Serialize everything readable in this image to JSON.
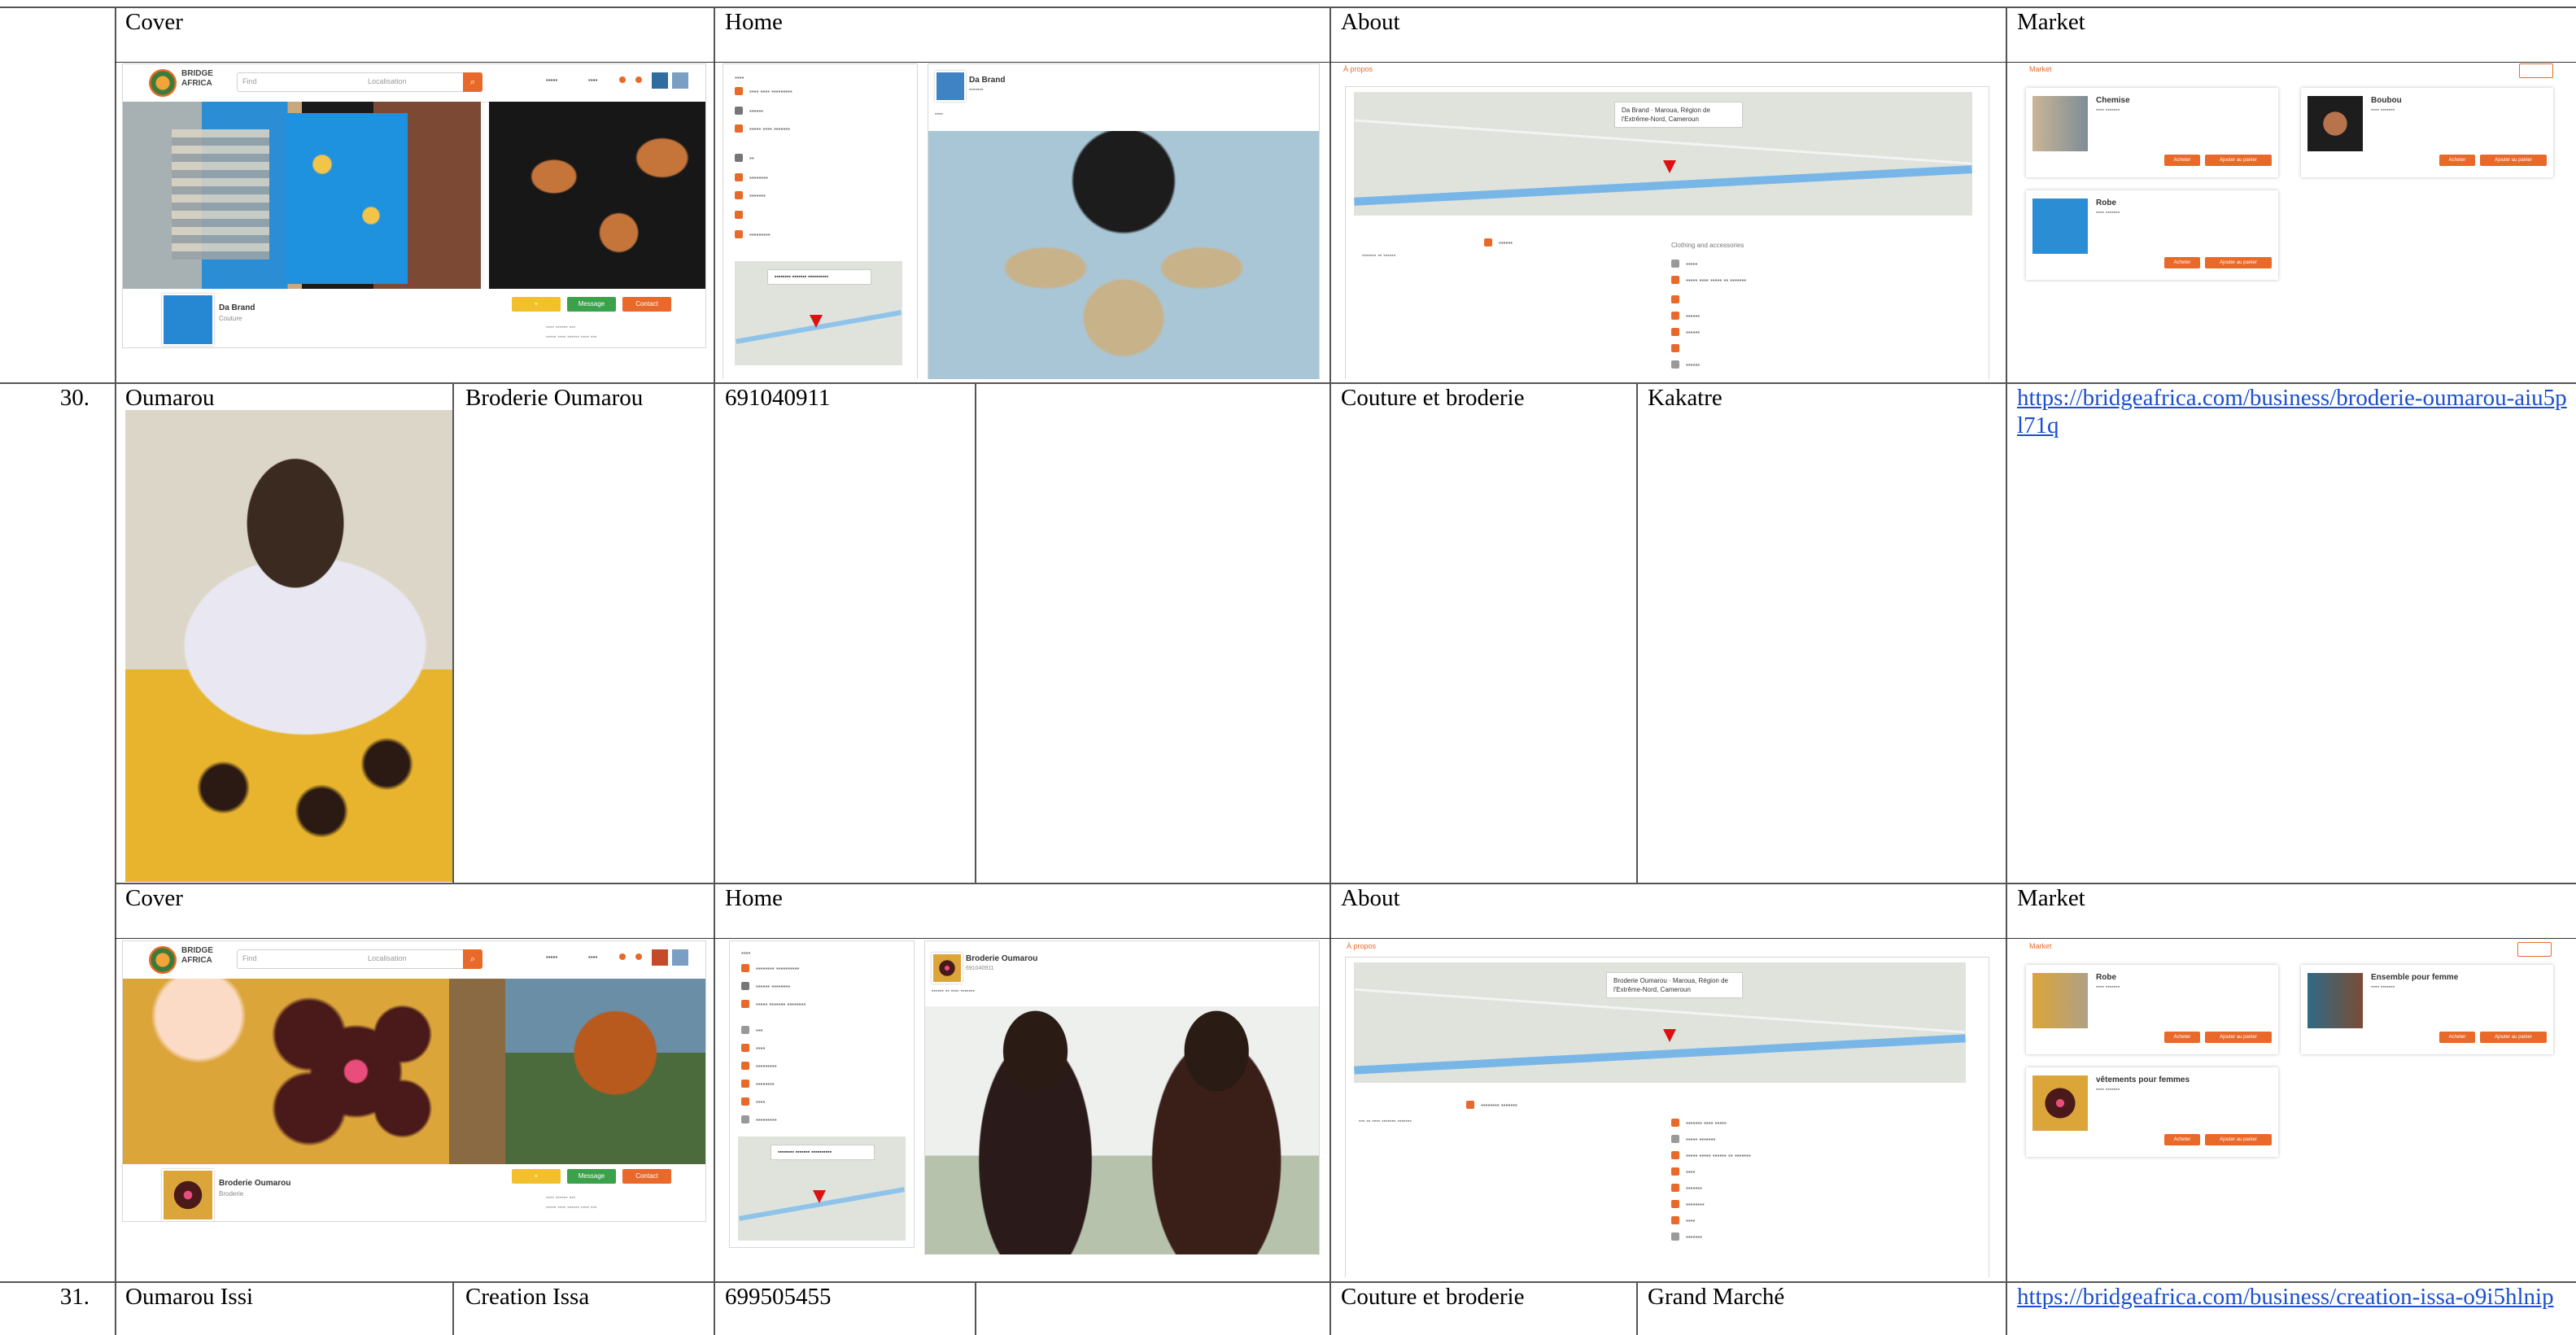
{
  "headers_top": {
    "cover": "Cover",
    "home": "Home",
    "about": "About",
    "market": "Market"
  },
  "row30": {
    "number": "30.",
    "owner": "Oumarou",
    "business": "Broderie Oumarou",
    "phone": "691040911",
    "category": "Couture et broderie",
    "location": "Kakatre",
    "url": "https://bridgeafrica.com/business/broderie-oumarou-aiu5pl71q"
  },
  "headers_mid": {
    "cover": "Cover",
    "home": "Home",
    "about": "About",
    "market": "Market"
  },
  "row31": {
    "number": "31.",
    "owner": "Oumarou Issi",
    "business": "Creation Issa",
    "phone": "699505455",
    "category": "Couture et broderie",
    "location": "Grand Marché",
    "url": "https://bridgeafrica.com/business/creation-issa-o9i5hlnip"
  },
  "shots": {
    "logo_text": "BRIDGE AFRICA",
    "search_what": "Find",
    "search_where": "Localisation",
    "top_profile_name": "Da Brand",
    "top_profile_sub": "Couture",
    "mid_profile_name": "Broderie Oumarou",
    "mid_profile_sub": "Broderie",
    "btn_message": "Message",
    "btn_contact": "Contact",
    "top_home_post_name": "Da Brand",
    "mid_home_post_name": "Broderie Oumarou",
    "mid_home_post_phone": "691040911",
    "map_callout_top": "Da Brand · Maroua, Région de l'Extrême-Nord, Cameroun",
    "map_callout_mid": "Broderie Oumarou · Maroua, Région de l'Extrême-Nord, Cameroun",
    "about_label": "À propos",
    "about_cat": "Clothing and accessories",
    "market_label": "Market",
    "top_market_items": [
      "Chemise",
      "Boubou",
      "Robe"
    ],
    "mid_market_items": [
      "Robe",
      "Ensemble pour femme",
      "vêtements pour femmes"
    ],
    "market_btn1": "Acheter",
    "market_btn2": "Ajouter au panier"
  },
  "colors": {
    "accent": "#e8692a",
    "link": "#1a4fd0",
    "grid": "#555555"
  }
}
